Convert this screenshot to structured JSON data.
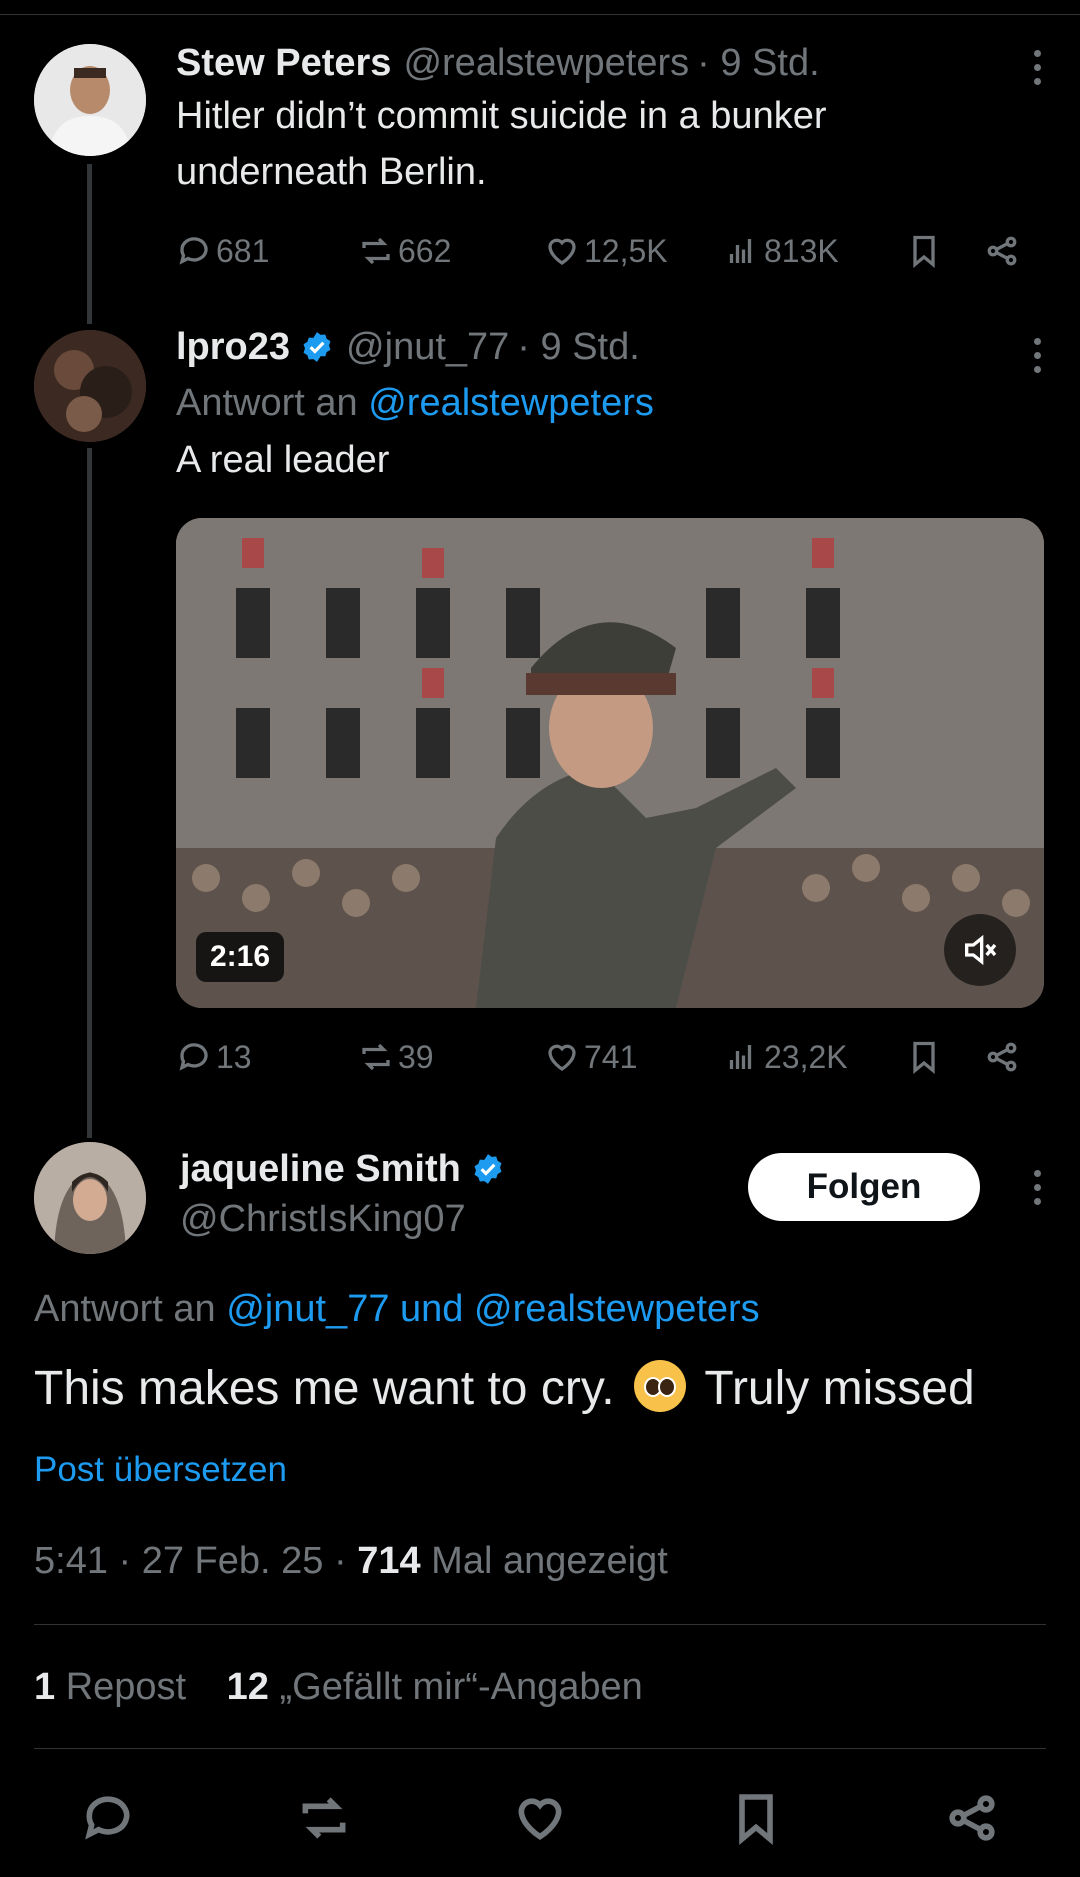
{
  "tweets": [
    {
      "name": "Stew Peters",
      "handle": "@realstewpeters",
      "time": "· 9 Std.",
      "text": "Hitler didn’t commit suicide in a bunker underneath Berlin.",
      "stats": {
        "replies": "681",
        "reposts": "662",
        "likes": "12,5K",
        "views": "813K"
      }
    },
    {
      "name": "lpro23",
      "handle": "@jnut_77",
      "time": "· 9 Std.",
      "reply_to_prefix": "Antwort an",
      "reply_to_handle": "@realstewpeters",
      "text": "A real leader",
      "video_duration": "2:16",
      "stats": {
        "replies": "13",
        "reposts": "39",
        "likes": "741",
        "views": "23,2K"
      }
    }
  ],
  "main_post": {
    "name": "jaqueline Smith",
    "handle": "@ChristIsKing07",
    "follow_label": "Folgen",
    "reply_to_prefix": "Antwort an",
    "reply_to_1": "@jnut_77",
    "reply_to_and": "und",
    "reply_to_2": "@realstewpeters",
    "text_before": "This makes me want to cry.",
    "text_after": "Truly missed",
    "translate_label": "Post übersetzen",
    "time": "5:41 · 27 Feb. 25 ·",
    "views_count": "714",
    "views_label": "Mal angezeigt",
    "reposts_count": "1",
    "reposts_label": "Repost",
    "likes_count": "12",
    "likes_label": "„Gefällt mir“-Angaben"
  },
  "colors": {
    "background": "#000000",
    "accent": "#1d9bf0",
    "muted": "#71767b",
    "text": "#e7e9ea"
  },
  "icons": [
    "reply-icon",
    "repost-icon",
    "like-icon",
    "views-icon",
    "bookmark-icon",
    "share-icon",
    "verified-icon",
    "more-icon",
    "mute-icon"
  ]
}
